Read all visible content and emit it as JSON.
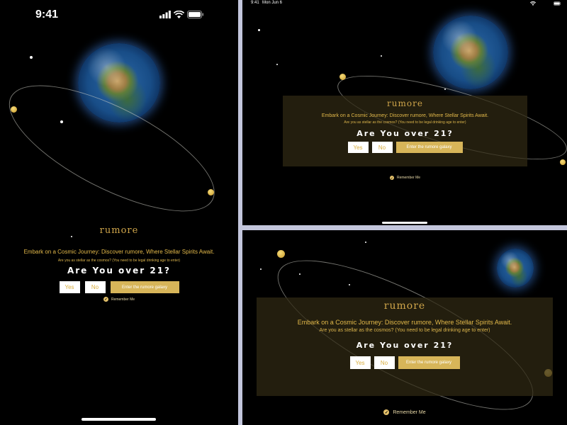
{
  "brand": "rumore",
  "headline": "Embark on a Cosmic Journey: Discover rumore, Where Stellar Spirits Await.",
  "subline": "Are you as stellar as the cosmos? (You need to be legal drinking age to enter)",
  "question": "Are You over 21?",
  "yes_label": "Yes",
  "no_label": "No",
  "enter_label": "Enter the rumore galaxy",
  "remember_label": "Remember Me",
  "phone": {
    "time": "9:41"
  },
  "tablet": {
    "time": "9:41",
    "date": "Mon Jun 6",
    "battery": "100%"
  },
  "colors": {
    "gold": "#d7b559",
    "text_gold": "#e3b94a",
    "background": "#000000",
    "frame": "#c3c6dc"
  },
  "icons": [
    "signal-icon",
    "wifi-icon",
    "battery-icon",
    "check-icon",
    "earth-image",
    "orbit-ring"
  ]
}
